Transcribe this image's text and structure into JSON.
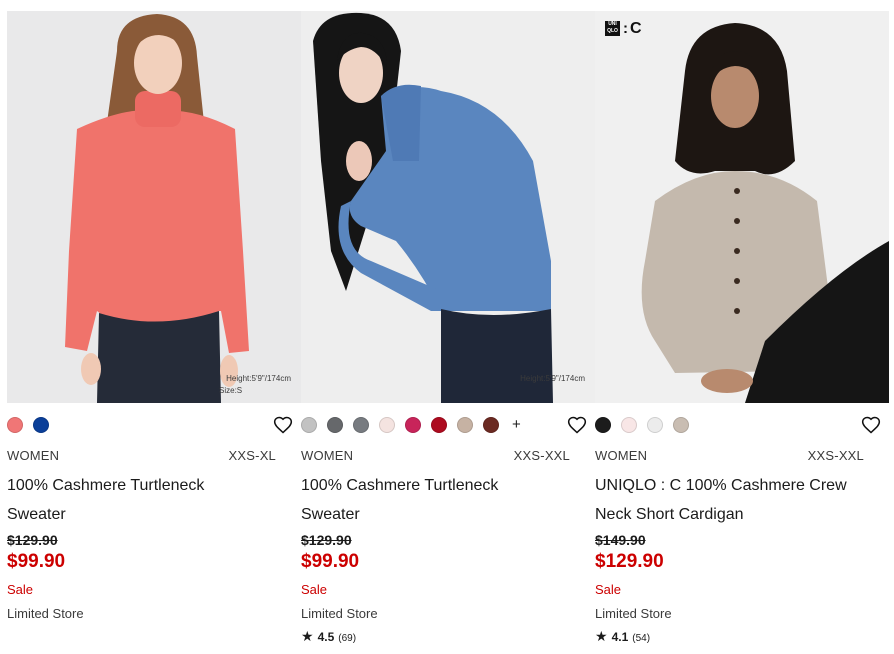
{
  "products": [
    {
      "gender": "WOMEN",
      "sizes": "XXS-XL",
      "name_line1": "100% Cashmere Turtleneck",
      "name_line2": "Sweater",
      "original_price": "$129.90",
      "sale_price": "$99.90",
      "sale_label": "Sale",
      "store_label": "Limited Store",
      "model_info": "Height:5'9\"/174cm",
      "model_info2": "Size:S",
      "colors": [
        "#f07676",
        "#0b3f99"
      ]
    },
    {
      "gender": "WOMEN",
      "sizes": "XXS-XXL",
      "name_line1": "100% Cashmere Turtleneck",
      "name_line2": "Sweater",
      "original_price": "$129.90",
      "sale_price": "$99.90",
      "sale_label": "Sale",
      "store_label": "Limited Store",
      "model_info": "Height:5'9\"/174cm",
      "rating": "4.5",
      "review_count": "(69)",
      "more_colors": "+",
      "colors": [
        "#c2c2c2",
        "#66686b",
        "#777b80",
        "#f4e3e0",
        "#c8245a",
        "#ad0b1f",
        "#c6b2a3",
        "#6b2a22"
      ]
    },
    {
      "brand": {
        "box_text": "UNI QLO",
        "suffix": "C"
      },
      "gender": "WOMEN",
      "sizes": "XXS-XXL",
      "name_line1": "UNIQLO : C 100% Cashmere Crew",
      "name_line2": "Neck Short Cardigan",
      "original_price": "$149.90",
      "sale_price": "$129.90",
      "sale_label": "Sale",
      "store_label": "Limited Store",
      "rating": "4.1",
      "review_count": "(54)",
      "colors": [
        "#1c1c1c",
        "#f8e6e6",
        "#ececec",
        "#c9bdb2"
      ]
    }
  ],
  "icons": {
    "favorite": "heart-outline-icon",
    "rating": "star-icon"
  },
  "accent_color": "#cc0000"
}
